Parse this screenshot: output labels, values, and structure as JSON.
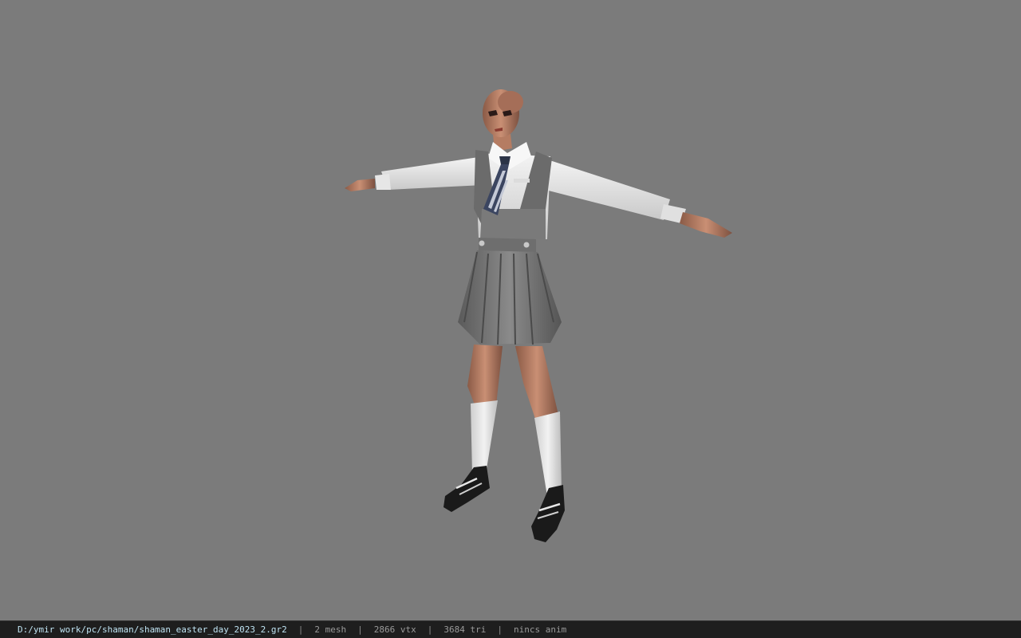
{
  "viewport": {
    "model_name": "shaman_easter_day_2023_2"
  },
  "statusbar": {
    "file_path": "D:/ymir work/pc/shaman/shaman_easter_day_2023_2.gr2",
    "separator": "|",
    "mesh_count": "2 mesh",
    "vertex_count": "2866 vtx",
    "triangle_count": "3684 tri",
    "anim_status": "nincs anim"
  },
  "colors": {
    "background": "#7b7b7b",
    "statusbar_bg": "#1e1e1e",
    "path_text": "#bfe3f2",
    "stat_text": "#9a9a9a"
  }
}
